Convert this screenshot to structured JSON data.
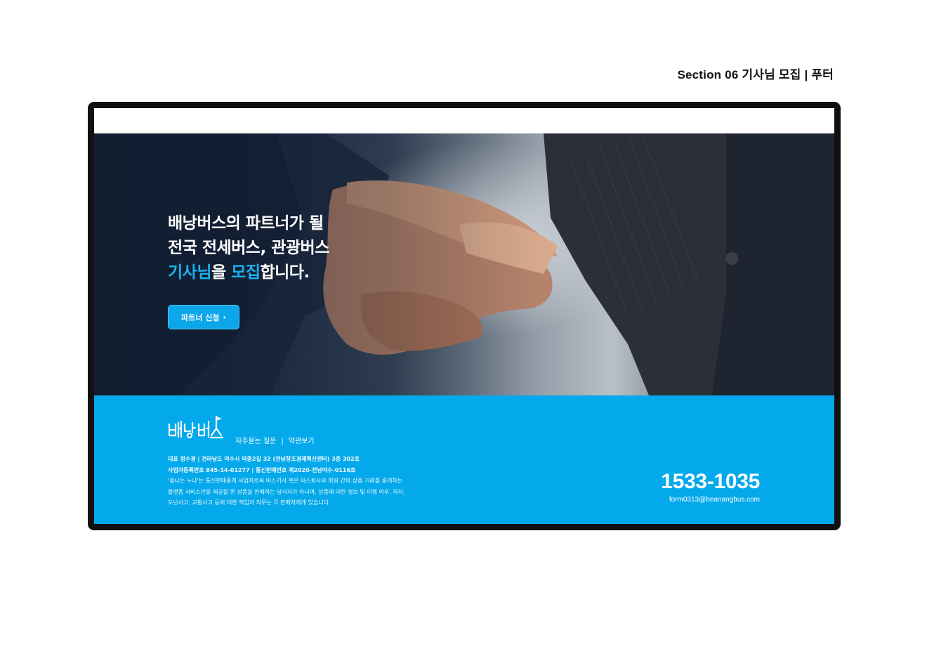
{
  "section_label": "Section 06  기사님 모집  |  푸터",
  "hero": {
    "line1": "배낭버스의 파트너가 될",
    "line2": "전국 전세버스, 관광버스",
    "line3_highlight1": "기사님",
    "line3_text1": "을 ",
    "line3_highlight2": "모집",
    "line3_text2": "합니다.",
    "cta_label": "파트너 신청",
    "cta_chevron": "›"
  },
  "footer": {
    "logo_text": "배낭버스",
    "link_faq": "자주묻는 질문",
    "link_sep": "|",
    "link_terms": "약관보기",
    "info_line1": "대표 정수경  |  전라남도 여수시 덕충2길 32 (전남창조경제혁신센터) 3층 302호",
    "info_line2": "사업자등록번호 845-14-01277  |  통신판매번호 제2020-전남여수-0116호",
    "info_line3": "'품나는 누나'는 통신판매중개 사업자로써 버스기사 혹은 버스회사와 회원 간의 상품 거래를 중개하는",
    "info_line4": "플랫폼 서비스만을 제공할 뿐 상품을 판매하는 당사자가 아니며, 상품에 대한 정보 및 이행 여부, 하자,",
    "info_line5": "도난사고, 교통사고 등에 대한 책임과 의무는 각 판매자에게 있습니다.",
    "phone": "1533-1035",
    "email": "form0313@beanangbus.com"
  },
  "colors": {
    "accent": "#03a9ea",
    "highlight": "#1ab1ef",
    "frame": "#111111"
  },
  "icons": {
    "cta": "chevron-right-icon",
    "logo": "flag-logo-icon"
  }
}
